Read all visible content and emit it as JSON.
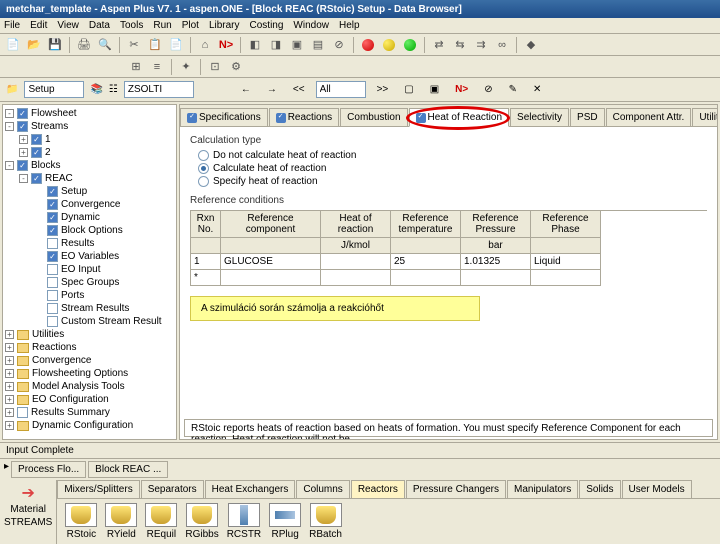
{
  "title": "metchar_template - Aspen Plus V7. 1 - aspen.ONE - [Block REAC (RStoic) Setup - Data Browser]",
  "menu": [
    "File",
    "Edit",
    "View",
    "Data",
    "Tools",
    "Run",
    "Plot",
    "Library",
    "Costing",
    "Window",
    "Help"
  ],
  "nav": {
    "left_combo": "Setup",
    "user_combo": "ZSOLTI",
    "all_combo": "All",
    "arrows": {
      "back": "←",
      "fwd": "→",
      "first": "<<",
      "next": ">>"
    },
    "np": "N>"
  },
  "tree": {
    "items": [
      {
        "lvl": 0,
        "exp": "-",
        "ico": "check",
        "label": "Flowsheet"
      },
      {
        "lvl": 0,
        "exp": "-",
        "ico": "check",
        "label": "Streams"
      },
      {
        "lvl": 1,
        "exp": "+",
        "ico": "check",
        "label": "1"
      },
      {
        "lvl": 1,
        "exp": "+",
        "ico": "check",
        "label": "2"
      },
      {
        "lvl": 0,
        "exp": "-",
        "ico": "check",
        "label": "Blocks"
      },
      {
        "lvl": 1,
        "exp": "-",
        "ico": "check",
        "label": "REAC"
      },
      {
        "lvl": 2,
        "exp": "",
        "ico": "check",
        "label": "Setup"
      },
      {
        "lvl": 2,
        "exp": "",
        "ico": "check",
        "label": "Convergence"
      },
      {
        "lvl": 2,
        "exp": "",
        "ico": "check",
        "label": "Dynamic"
      },
      {
        "lvl": 2,
        "exp": "",
        "ico": "check",
        "label": "Block Options"
      },
      {
        "lvl": 2,
        "exp": "",
        "ico": "empty",
        "label": "Results"
      },
      {
        "lvl": 2,
        "exp": "",
        "ico": "check",
        "label": "EO Variables"
      },
      {
        "lvl": 2,
        "exp": "",
        "ico": "empty",
        "label": "EO Input"
      },
      {
        "lvl": 2,
        "exp": "",
        "ico": "empty",
        "label": "Spec Groups"
      },
      {
        "lvl": 2,
        "exp": "",
        "ico": "empty",
        "label": "Ports"
      },
      {
        "lvl": 2,
        "exp": "",
        "ico": "empty",
        "label": "Stream Results"
      },
      {
        "lvl": 2,
        "exp": "",
        "ico": "empty",
        "label": "Custom Stream Result"
      },
      {
        "lvl": 0,
        "exp": "+",
        "ico": "folder",
        "label": "Utilities"
      },
      {
        "lvl": 0,
        "exp": "+",
        "ico": "folder",
        "label": "Reactions"
      },
      {
        "lvl": 0,
        "exp": "+",
        "ico": "folder",
        "label": "Convergence"
      },
      {
        "lvl": 0,
        "exp": "+",
        "ico": "folder",
        "label": "Flowsheeting Options"
      },
      {
        "lvl": 0,
        "exp": "+",
        "ico": "folder",
        "label": "Model Analysis Tools"
      },
      {
        "lvl": 0,
        "exp": "+",
        "ico": "folder",
        "label": "EO Configuration"
      },
      {
        "lvl": 0,
        "exp": "+",
        "ico": "empty",
        "label": "Results Summary"
      },
      {
        "lvl": 0,
        "exp": "+",
        "ico": "folder",
        "label": "Dynamic Configuration"
      }
    ]
  },
  "tabs": [
    "Specifications",
    "Reactions",
    "Combustion",
    "Heat of Reaction",
    "Selectivity",
    "PSD",
    "Component Attr.",
    "Utility"
  ],
  "form": {
    "group1": "Calculation type",
    "radio1": "Do not calculate heat of reaction",
    "radio2": "Calculate heat of reaction",
    "radio3": "Specify heat of reaction",
    "group2": "Reference conditions",
    "headers": [
      "Rxn No.",
      "Reference component",
      "Heat of reaction",
      "Reference temperature",
      "Reference Pressure",
      "Reference Phase"
    ],
    "units": [
      "",
      "",
      "J/kmol",
      "bar",
      ""
    ],
    "row": {
      "rxn": "1",
      "comp": "GLUCOSE",
      "heat": "",
      "temp": "25",
      "press": "1.01325",
      "phase": "Liquid"
    }
  },
  "note": "A szimuláció során számolja a reakcióhőt",
  "info": "RStoic reports heats of reaction based on heats of formation. You must specify Reference Component for each reaction. Heat of reaction will not be",
  "status": "Input Complete",
  "bottom_tabs": [
    "Process Flo...",
    "Block REAC ..."
  ],
  "palette": {
    "stream_label": "Material",
    "stream_label2": "STREAMS",
    "cats": [
      "Mixers/Splitters",
      "Separators",
      "Heat Exchangers",
      "Columns",
      "Reactors",
      "Pressure Changers",
      "Manipulators",
      "Solids",
      "User Models"
    ],
    "items": [
      "RStoic",
      "RYield",
      "REquil",
      "RGibbs",
      "RCSTR",
      "RPlug",
      "RBatch"
    ]
  }
}
